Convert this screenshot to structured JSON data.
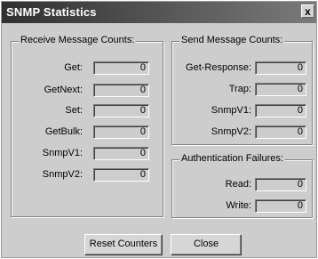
{
  "window": {
    "title": "SNMP Statistics",
    "close_glyph": "x"
  },
  "receive": {
    "legend": "Receive Message Counts:",
    "rows": [
      {
        "label": "Get:",
        "value": "0"
      },
      {
        "label": "GetNext:",
        "value": "0"
      },
      {
        "label": "Set:",
        "value": "0"
      },
      {
        "label": "GetBulk:",
        "value": "0"
      },
      {
        "label": "SnmpV1:",
        "value": "0"
      },
      {
        "label": "SnmpV2:",
        "value": "0"
      }
    ]
  },
  "send": {
    "legend": "Send Message Counts:",
    "rows": [
      {
        "label": "Get-Response:",
        "value": "0"
      },
      {
        "label": "Trap:",
        "value": "0"
      },
      {
        "label": "SnmpV1:",
        "value": "0"
      },
      {
        "label": "SnmpV2:",
        "value": "0"
      }
    ]
  },
  "auth": {
    "legend": "Authentication Failures:",
    "rows": [
      {
        "label": "Read:",
        "value": "0"
      },
      {
        "label": "Write:",
        "value": "0"
      }
    ]
  },
  "buttons": {
    "reset": "Reset Counters",
    "close": "Close"
  }
}
